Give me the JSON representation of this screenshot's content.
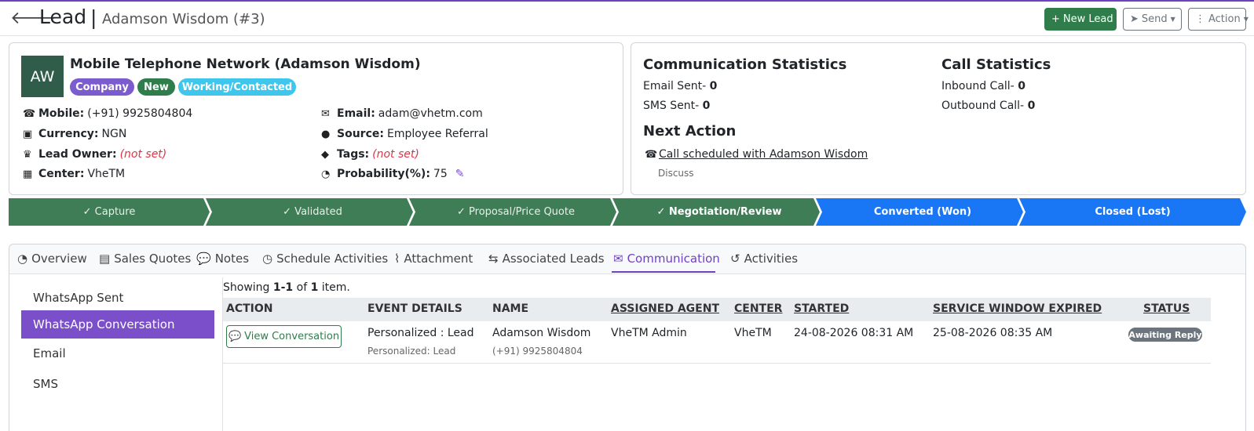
{
  "header": {
    "title": "Lead",
    "separator": "|",
    "subtitle": "Adamson Wisdom (#3)",
    "back_icon": "arrow-left-icon",
    "new_lead_label": "New Lead",
    "send_label": "Send",
    "action_label": "Action"
  },
  "colors": {
    "accent": "#6f42c1",
    "success": "#2e7d4a",
    "stage_done": "#3f7d56",
    "stage_future": "#1976f5",
    "info": "#3ec6ec"
  },
  "lead": {
    "initials": "AW",
    "name": "Mobile Telephone Network (Adamson Wisdom)",
    "badges": [
      "Company",
      "New",
      "Working/Contacted"
    ],
    "mobile_label": "Mobile:",
    "mobile": "(+91) 9925804804",
    "currency_label": "Currency:",
    "currency": "NGN",
    "owner_label": "Lead Owner:",
    "owner": "(not set)",
    "center_label": "Center:",
    "center": "VheTM",
    "email_label": "Email:",
    "email": "adam@vhetm.com",
    "source_label": "Source:",
    "source": "Employee Referral",
    "tags_label": "Tags:",
    "tags": "(not set)",
    "probability_label": "Probability(%):",
    "probability": "75"
  },
  "communication_stats": {
    "title": "Communication Statistics",
    "email_label": "Email Sent-",
    "email_value": "0",
    "sms_label": "SMS Sent-",
    "sms_value": "0"
  },
  "call_stats": {
    "title": "Call Statistics",
    "inbound_label": "Inbound Call-",
    "inbound_value": "0",
    "outbound_label": "Outbound Call-",
    "outbound_value": "0"
  },
  "next_action": {
    "title": "Next Action",
    "link": "Call scheduled with Adamson Wisdom",
    "note": "Discuss"
  },
  "stages": [
    {
      "label": "✓ Capture",
      "state": "done"
    },
    {
      "label": "✓ Validated",
      "state": "done"
    },
    {
      "label": "✓ Proposal/Price Quote",
      "state": "done"
    },
    {
      "label": "✓ Negotiation/Review",
      "state": "active"
    },
    {
      "label": "Converted (Won)",
      "state": "future"
    },
    {
      "label": "Closed (Lost)",
      "state": "future"
    }
  ],
  "tabs": [
    {
      "label": "Overview",
      "icon": "gauge-icon"
    },
    {
      "label": "Sales Quotes",
      "icon": "calculator-icon"
    },
    {
      "label": "Notes",
      "icon": "comments-icon"
    },
    {
      "label": "Schedule Activities",
      "icon": "clock-icon"
    },
    {
      "label": "Attachment",
      "icon": "paperclip-icon"
    },
    {
      "label": "Associated Leads",
      "icon": "people-arrows-icon"
    },
    {
      "label": "Communication",
      "icon": "envelope-open-icon",
      "active": true
    },
    {
      "label": "Activities",
      "icon": "history-icon"
    }
  ],
  "side_menu": [
    "WhatsApp Sent",
    "WhatsApp Conversation",
    "Email",
    "SMS"
  ],
  "table": {
    "showing_prefix": "Showing ",
    "showing_range": "1-1",
    "showing_of": " of ",
    "showing_total": "1",
    "showing_suffix": " item.",
    "headers": [
      "ACTION",
      "EVENT DETAILS",
      "NAME",
      "ASSIGNED AGENT",
      "CENTER",
      "STARTED",
      "SERVICE WINDOW EXPIRED",
      "STATUS"
    ],
    "rows": [
      {
        "action": "View Conversation",
        "event": "Personalized : Lead",
        "event_sub": "Personalized: Lead",
        "name": "Adamson Wisdom",
        "name_sub": "(+91) 9925804804",
        "agent": "VheTM Admin",
        "center": "VheTM",
        "started": "24-08-2026 08:31 AM",
        "expired": "25-08-2026 08:35 AM",
        "status": "Awaiting Reply"
      }
    ]
  }
}
